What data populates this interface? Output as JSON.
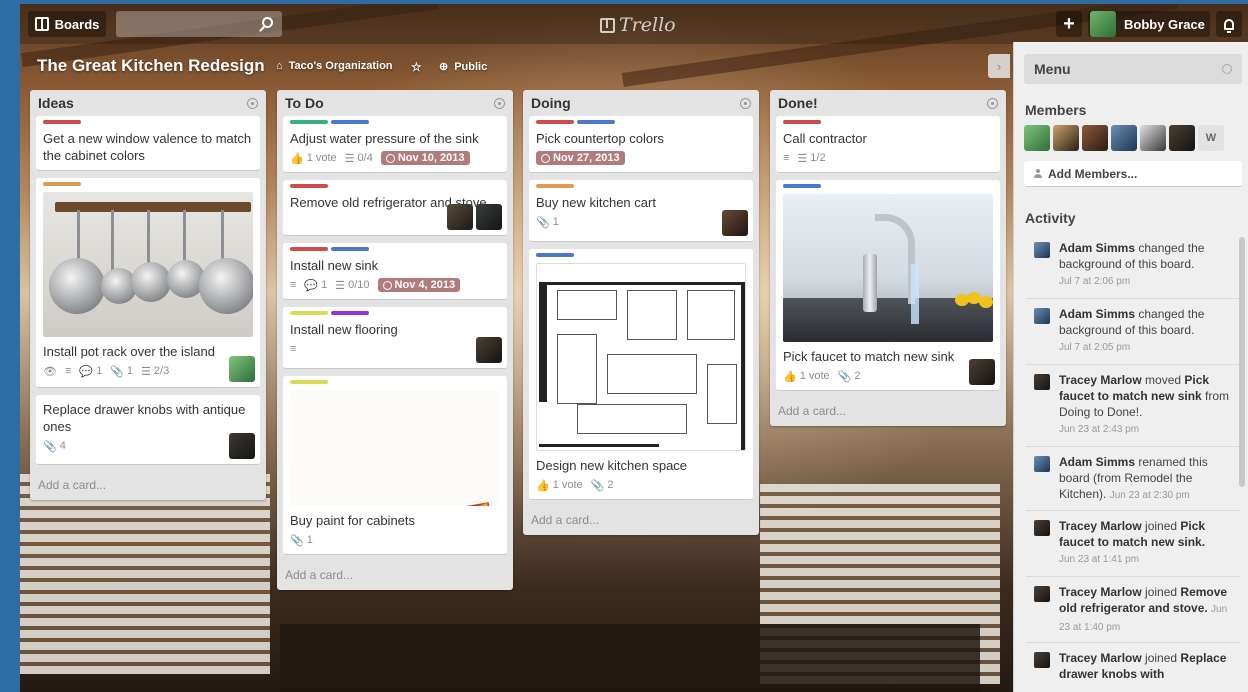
{
  "header": {
    "boards_label": "Boards",
    "search_placeholder": "",
    "logo_text": "Trello",
    "plus_label": "+",
    "user_name": "Bobby Grace"
  },
  "board": {
    "title": "The Great Kitchen Redesign",
    "org": "Taco's Organization",
    "star": "☆",
    "visibility": "Public"
  },
  "lists": [
    {
      "title": "Ideas",
      "add_card": "Add a card...",
      "cards": [
        {
          "title": "Get a new window valence to match the cabinet colors"
        },
        {
          "title": "Install pot rack over the island",
          "badges": [
            "1",
            "1",
            "2/3"
          ]
        },
        {
          "title": "Replace drawer knobs with antique ones",
          "badges": [
            "4"
          ]
        }
      ]
    },
    {
      "title": "To Do",
      "add_card": "Add a card...",
      "cards": [
        {
          "title": "Adjust water pressure of the sink",
          "badges": [
            "1 vote",
            "0/4"
          ],
          "due": "Nov 10, 2013"
        },
        {
          "title": "Remove old refrigerator and stove"
        },
        {
          "title": "Install new sink",
          "badges": [
            "1",
            "0/10"
          ],
          "due": "Nov 4, 2013"
        },
        {
          "title": "Install new flooring"
        },
        {
          "title": "Buy paint for cabinets",
          "badges": [
            "1"
          ]
        }
      ]
    },
    {
      "title": "Doing",
      "add_card": "Add a card...",
      "cards": [
        {
          "title": "Pick countertop colors",
          "due": "Nov 27, 2013"
        },
        {
          "title": "Buy new kitchen cart",
          "badges": [
            "1"
          ]
        },
        {
          "title": "Design new kitchen space",
          "badges": [
            "1 vote",
            "2"
          ]
        }
      ]
    },
    {
      "title": "Done!",
      "add_card": "Add a card...",
      "cards": [
        {
          "title": "Call contractor",
          "badges": [
            "1/2"
          ]
        },
        {
          "title": "Pick faucet to match new sink",
          "badges": [
            "1 vote",
            "2"
          ]
        }
      ]
    }
  ],
  "menu": {
    "title": "Menu",
    "members_title": "Members",
    "member_initial": "W",
    "add_members": "Add Members...",
    "activity_title": "Activity",
    "activity": [
      {
        "who": "Adam Simms",
        "what": " changed the background of this board.",
        "time": "Jul 7 at 2:06 pm"
      },
      {
        "who": "Adam Simms",
        "what": " changed the background of this board.",
        "time": "Jul 7 at 2:05 pm"
      },
      {
        "who": "Tracey Marlow",
        "what": " moved ",
        "target": "Pick faucet to match new sink",
        "rest": " from Doing to Done!.",
        "time": "Jun 23 at 2:43 pm"
      },
      {
        "who": "Adam Simms",
        "what": " renamed this board (from Remodel the Kitchen).",
        "time": "Jun 23 at 2:30 pm"
      },
      {
        "who": "Tracey Marlow",
        "what": " joined ",
        "target": "Pick faucet to match new sink.",
        "time": "Jun 23 at 1:41 pm"
      },
      {
        "who": "Tracey Marlow",
        "what": " joined ",
        "target": "Remove old refrigerator and stove.",
        "time": "Jun 23 at 1:40 pm"
      },
      {
        "who": "Tracey Marlow",
        "what": " joined ",
        "target": "Replace drawer knobs with"
      }
    ]
  },
  "colors": {
    "label_red": "#cb4d4d",
    "label_orange": "#e09952",
    "label_green": "#34b27d",
    "label_blue": "#4d77cb",
    "label_purple": "#93c",
    "label_yellow": "#dbdb57",
    "due_badge": "#b27b7b"
  }
}
